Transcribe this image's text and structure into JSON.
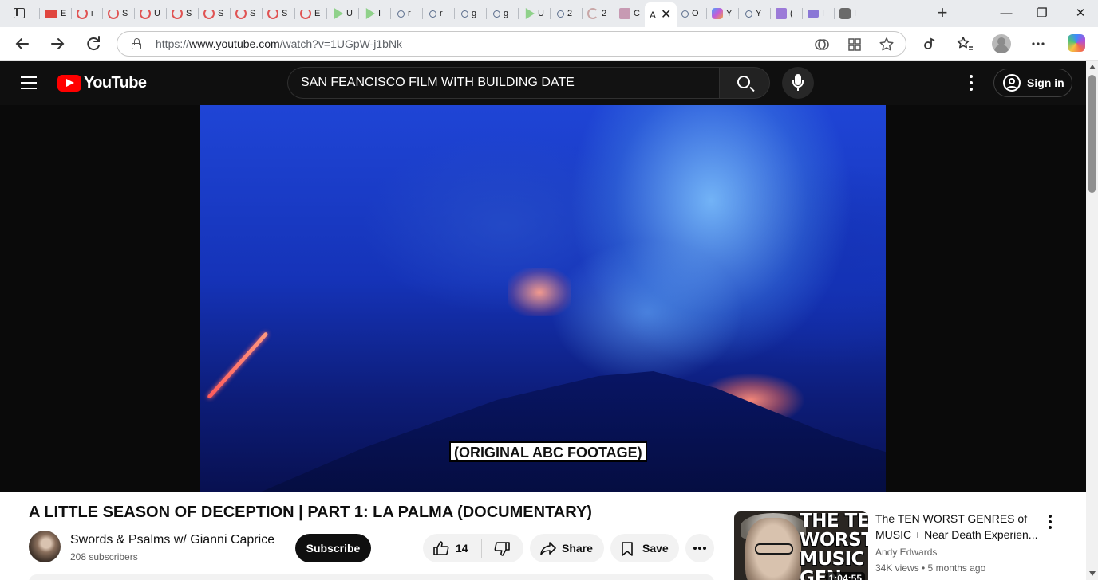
{
  "browser": {
    "tab_strip": {
      "tab_initials": [
        "E",
        "i",
        "S",
        "U",
        "S",
        "S",
        "S",
        "S",
        "E",
        "U",
        "I",
        "r",
        "r",
        "g",
        "g",
        "U",
        "2",
        "2",
        "C",
        "O",
        "Y",
        "Y",
        "(",
        "I",
        "I"
      ],
      "active_tab_initial": "A",
      "active_tab_close": "✕",
      "new_tab_label": "+",
      "window_controls": {
        "minimize": "—",
        "restore": "❐",
        "close": "✕"
      }
    },
    "address_bar": {
      "url_prefix": "https://",
      "url_host": "www.youtube.com",
      "url_path": "/watch?v=1UGpW-j1bNk"
    }
  },
  "youtube": {
    "logo_text": "YouTube",
    "search": {
      "query": "SAN FEANCISCO FILM WITH BUILDING DATE"
    },
    "sign_in_label": "Sign in",
    "player": {
      "caption": "(ORIGINAL ABC FOOTAGE)"
    },
    "video": {
      "title": "A LITTLE SEASON OF DECEPTION | PART 1: LA PALMA (DOCUMENTARY)",
      "channel_name": "Swords & Psalms w/ Gianni Caprice",
      "subscribers": "208 subscribers",
      "subscribe_label": "Subscribe",
      "like_count": "14",
      "share_label": "Share",
      "save_label": "Save"
    },
    "related": [
      {
        "thumbnail_text": [
          "THE TEN",
          "WORST",
          "MUSIC",
          "GEN"
        ],
        "duration": "1:04:55",
        "title_line1": "The TEN WORST GENRES of",
        "title_line2": "MUSIC + Near Death Experien...",
        "channel": "Andy Edwards",
        "meta": "34K views • 5 months ago"
      }
    ]
  },
  "colors": {
    "yt_red": "#ff0000",
    "masthead_bg": "#0f0f0f",
    "subscribe_bg": "#0f0f0f",
    "pill_bg": "#f2f2f2"
  }
}
